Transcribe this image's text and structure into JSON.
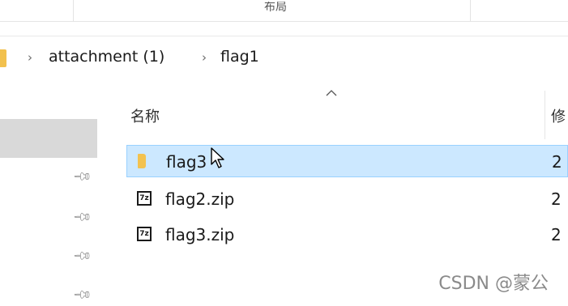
{
  "ribbon": {
    "label": "布局"
  },
  "breadcrumb": {
    "items": [
      "attachment (1)",
      "flag1"
    ]
  },
  "columns": {
    "name": "名称",
    "modified": "修"
  },
  "files": [
    {
      "name": "flag3",
      "type": "folder",
      "date": "2",
      "icon": "folder-icon"
    },
    {
      "name": "flag2.zip",
      "type": "7z-archive",
      "date": "2",
      "icon": "7z-icon",
      "icon_text": "7z"
    },
    {
      "name": "flag3.zip",
      "type": "7z-archive",
      "date": "2",
      "icon": "7z-icon",
      "icon_text": "7z"
    }
  ],
  "watermark": "CSDN @蒙公",
  "colors": {
    "selection_bg": "#cce8ff",
    "selection_border": "#99d1ff",
    "folder": "#f3c24f",
    "nav_selected": "#d9d9d9"
  }
}
